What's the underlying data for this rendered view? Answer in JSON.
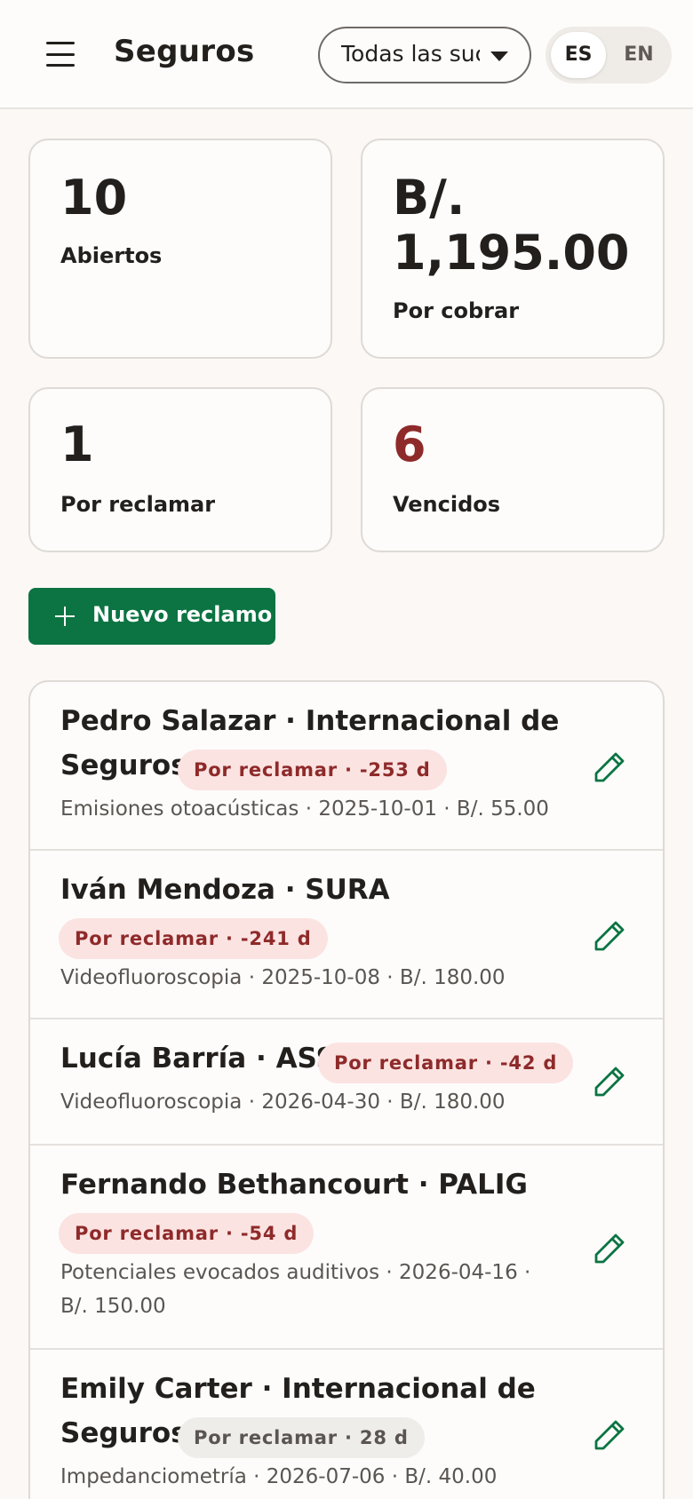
{
  "header": {
    "title": "Seguros",
    "branch_select": "Todas las sucursales",
    "lang": {
      "es": "ES",
      "en": "EN",
      "active": "ES"
    }
  },
  "stats": [
    {
      "value": "10",
      "label": "Abiertos"
    },
    {
      "value_line1": "B/.",
      "value_line2": "1,195.00",
      "label": "Por cobrar"
    },
    {
      "value": "1",
      "label": "Por reclamar"
    },
    {
      "value": "6",
      "label": "Vencidos",
      "color": "#8e2a2a"
    }
  ],
  "new_claim_label": "Nuevo reclamo",
  "colors": {
    "primary": "#0b7442",
    "danger": "#8e2a2a",
    "danger_bg": "#fbe3e1"
  },
  "claims": [
    {
      "title_line1": "Pedro Salazar · Internacional de",
      "title_line2": "Seguros",
      "badge": "Por reclamar · -253 d",
      "detail": "Emisiones otoacústicas · 2025-10-01 · B/. 55.00"
    },
    {
      "title": "Iván Mendoza · SURA",
      "badge": "Por reclamar · -241 d",
      "detail": "Videofluoroscopia · 2025-10-08 · B/. 180.00"
    },
    {
      "title": "Lucía Barría · ASSA",
      "badge": "Por reclamar · -42 d",
      "detail": "Videofluoroscopia · 2026-04-30 · B/. 180.00"
    },
    {
      "title": "Fernando Bethancourt · PALIG",
      "badge": "Por reclamar · -54 d",
      "detail_line1": "Potenciales evocados auditivos · 2026-04-16 ·",
      "detail_line2": "B/. 150.00"
    },
    {
      "title_line1": "Emily Carter · Internacional de",
      "title_line2": "Seguros",
      "badge": "Por reclamar · 28 d",
      "detail": "Impedanciometría · 2026-07-06 · B/. 40.00"
    }
  ]
}
